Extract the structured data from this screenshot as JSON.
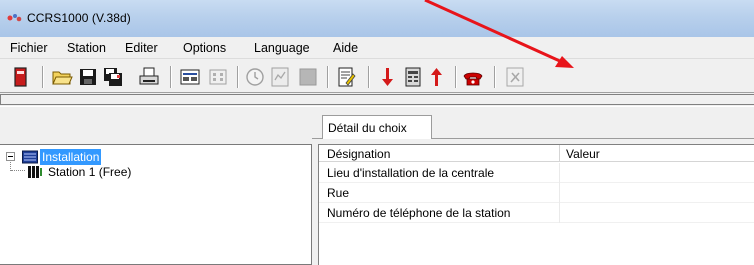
{
  "window": {
    "title": "CCRS1000 (V.38d)"
  },
  "menu": [
    "Fichier",
    "Station",
    "Editer",
    "Options",
    "Language",
    "Aide"
  ],
  "toolbar": {
    "buttons": [
      "red-device-icon",
      "open-folder-icon",
      "save-disk-icon",
      "save-multiple-icon",
      "print-icon",
      "station-panel-icon",
      "keypad-disabled-icon",
      "clock-disabled-icon",
      "network-disabled-icon",
      "square-disabled-icon",
      "edit-document-icon",
      "download-arrow-icon",
      "device-module-icon",
      "upload-arrow-icon",
      "telephone-icon",
      "tools-disabled-icon"
    ]
  },
  "tree": {
    "root_label": "Installation",
    "children": [
      "Station 1 (Free)"
    ]
  },
  "tab": {
    "label": "Détail du choix"
  },
  "grid": {
    "columns": [
      "Désignation",
      "Valeur"
    ],
    "rows": [
      {
        "designation": "Lieu d'installation de la centrale",
        "valeur": ""
      },
      {
        "designation": "Rue",
        "valeur": ""
      },
      {
        "designation": "Numéro de téléphone de la station",
        "valeur": ""
      }
    ]
  },
  "colors": {
    "selection": "#3399ff",
    "annotation_arrow": "#e8141a",
    "telephone": "#cc0000"
  }
}
